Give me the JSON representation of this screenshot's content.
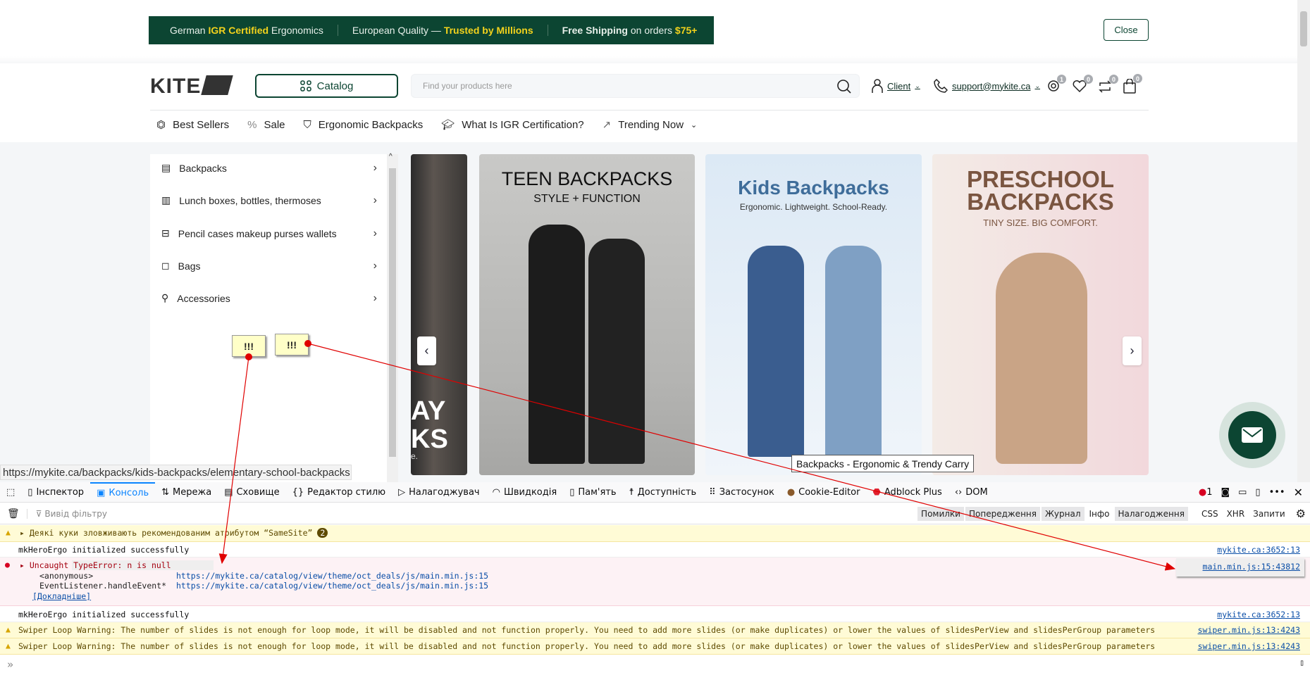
{
  "promo": {
    "part1_pre": "German ",
    "part1_hl": "IGR Certified",
    "part1_post": " Ergonomics",
    "part2_pre": "European Quality — ",
    "part2_hl": "Trusted by Millions",
    "part3_hl1": "Free Shipping",
    "part3_mid": " on orders ",
    "part3_hl2": "$75+",
    "close_label": "Close"
  },
  "header": {
    "logo": "KITE",
    "catalog_label": "Catalog",
    "search_placeholder": "Find your products here",
    "client_label": "Client",
    "email": "support@mykite.ca",
    "badges": {
      "viewed": "1",
      "wishlist": "0",
      "compare": "0",
      "cart": "0"
    }
  },
  "nav": [
    "Best Sellers",
    "Sale",
    "Ergonomic Backpacks",
    "What Is IGR Certification?",
    "Trending Now"
  ],
  "menu": [
    "Backpacks",
    "Lunch boxes, bottles, thermoses",
    "Pencil cases makeup purses wallets",
    "Bags",
    "Accessories"
  ],
  "slides": {
    "partial": {
      "line1": "AY",
      "line2": "KS",
      "line3": "e."
    },
    "teen": {
      "title": "TEEN BACKPACKS",
      "subtitle": "STYLE + FUNCTION"
    },
    "kids": {
      "title": "Kids Backpacks",
      "subtitle": "Ergonomic. Lightweight. School-Ready."
    },
    "preschool": {
      "title1": "PRESCHOOL",
      "title2": "BACKPACKS",
      "subtitle": "TINY SIZE. BIG COMFORT."
    }
  },
  "tooltip": "Backpacks - Ergonomic & Trendy Carry",
  "status_url": "https://mykite.ca/backpacks/kids-backpacks/elementary-school-backpacks",
  "annotations": {
    "note1": "!!!",
    "note2": "!!!"
  },
  "devtools": {
    "tabs": [
      "Інспектор",
      "Консоль",
      "Мережа",
      "Сховище",
      "Редактор стилю",
      "Налагоджувач",
      "Швидкодія",
      "Пам'ять",
      "Доступність",
      "Застосунок",
      "Cookie-Editor",
      "Adblock Plus",
      "DOM"
    ],
    "error_count": "1",
    "filter_placeholder": "Вивід фільтру",
    "filters": [
      "Помилки",
      "Попередження",
      "Журнал",
      "Інфо",
      "Налагодження"
    ],
    "filters2": [
      "CSS",
      "XHR",
      "Запити"
    ],
    "samesite": {
      "text": "Деякі куки зловживають рекомендованим атрибутом “SameSite”",
      "count": "2"
    },
    "log1": {
      "text": "mkHeroErgo initialized successfully",
      "src": "mykite.ca:3652:13"
    },
    "error": {
      "text": "Uncaught TypeError: n is null",
      "src": "main.min.js:15:43812",
      "frame1_fn": "<anonymous>",
      "frame1_url": "https://mykite.ca/catalog/view/theme/oct_deals/js/main.min.js:15",
      "frame2_fn": "EventListener.handleEvent*",
      "frame2_url": "https://mykite.ca/catalog/view/theme/oct_deals/js/main.min.js:15",
      "more": "[Докладніше]"
    },
    "log2": {
      "text": "mkHeroErgo initialized successfully",
      "src": "mykite.ca:3652:13"
    },
    "swiper1": {
      "text": "Swiper Loop Warning: The number of slides is not enough for loop mode, it will be disabled and not function properly. You need to add more slides (or make duplicates) or lower the values of slidesPerView and slidesPerGroup parameters",
      "src": "swiper.min.js:13:4243"
    },
    "swiper2": {
      "text": "Swiper Loop Warning: The number of slides is not enough for loop mode, it will be disabled and not function properly. You need to add more slides (or make duplicates) or lower the values of slidesPerView and slidesPerGroup parameters",
      "src": "swiper.min.js:13:4243"
    },
    "prompt": "»"
  },
  "colors": {
    "brand": "#0c4532",
    "highlight": "#f3d21c",
    "annotation": "#e00000"
  }
}
